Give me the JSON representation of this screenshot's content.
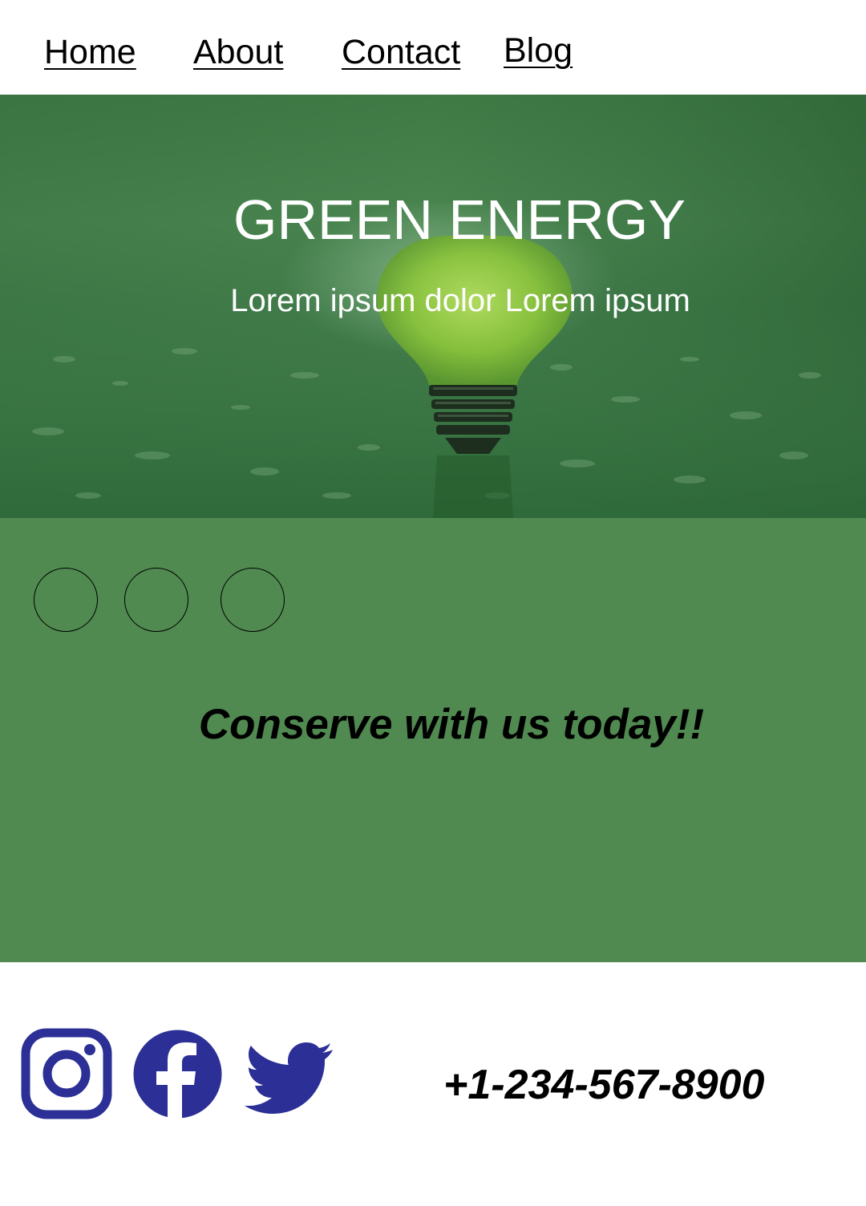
{
  "nav": {
    "items": [
      {
        "label": "Home"
      },
      {
        "label": "About"
      },
      {
        "label": "Contact"
      },
      {
        "label": "Blog"
      }
    ]
  },
  "hero": {
    "title": "GREEN ENERGY",
    "subtitle": "Lorem ipsum dolor Lorem ipsum",
    "image": "green-lightbulb-on-wet-surface"
  },
  "panel": {
    "carousel_dots": 3,
    "tagline": "Conserve with us today!!"
  },
  "footer": {
    "social": [
      {
        "icon": "instagram-icon"
      },
      {
        "icon": "facebook-icon"
      },
      {
        "icon": "twitter-icon"
      }
    ],
    "phone": "+1-234-567-8900"
  },
  "colors": {
    "panel_green": "#508a50",
    "hero_green": "#3f7a45",
    "social_blue": "#2b2f96",
    "text": "#000000",
    "hero_text": "#ffffff"
  }
}
